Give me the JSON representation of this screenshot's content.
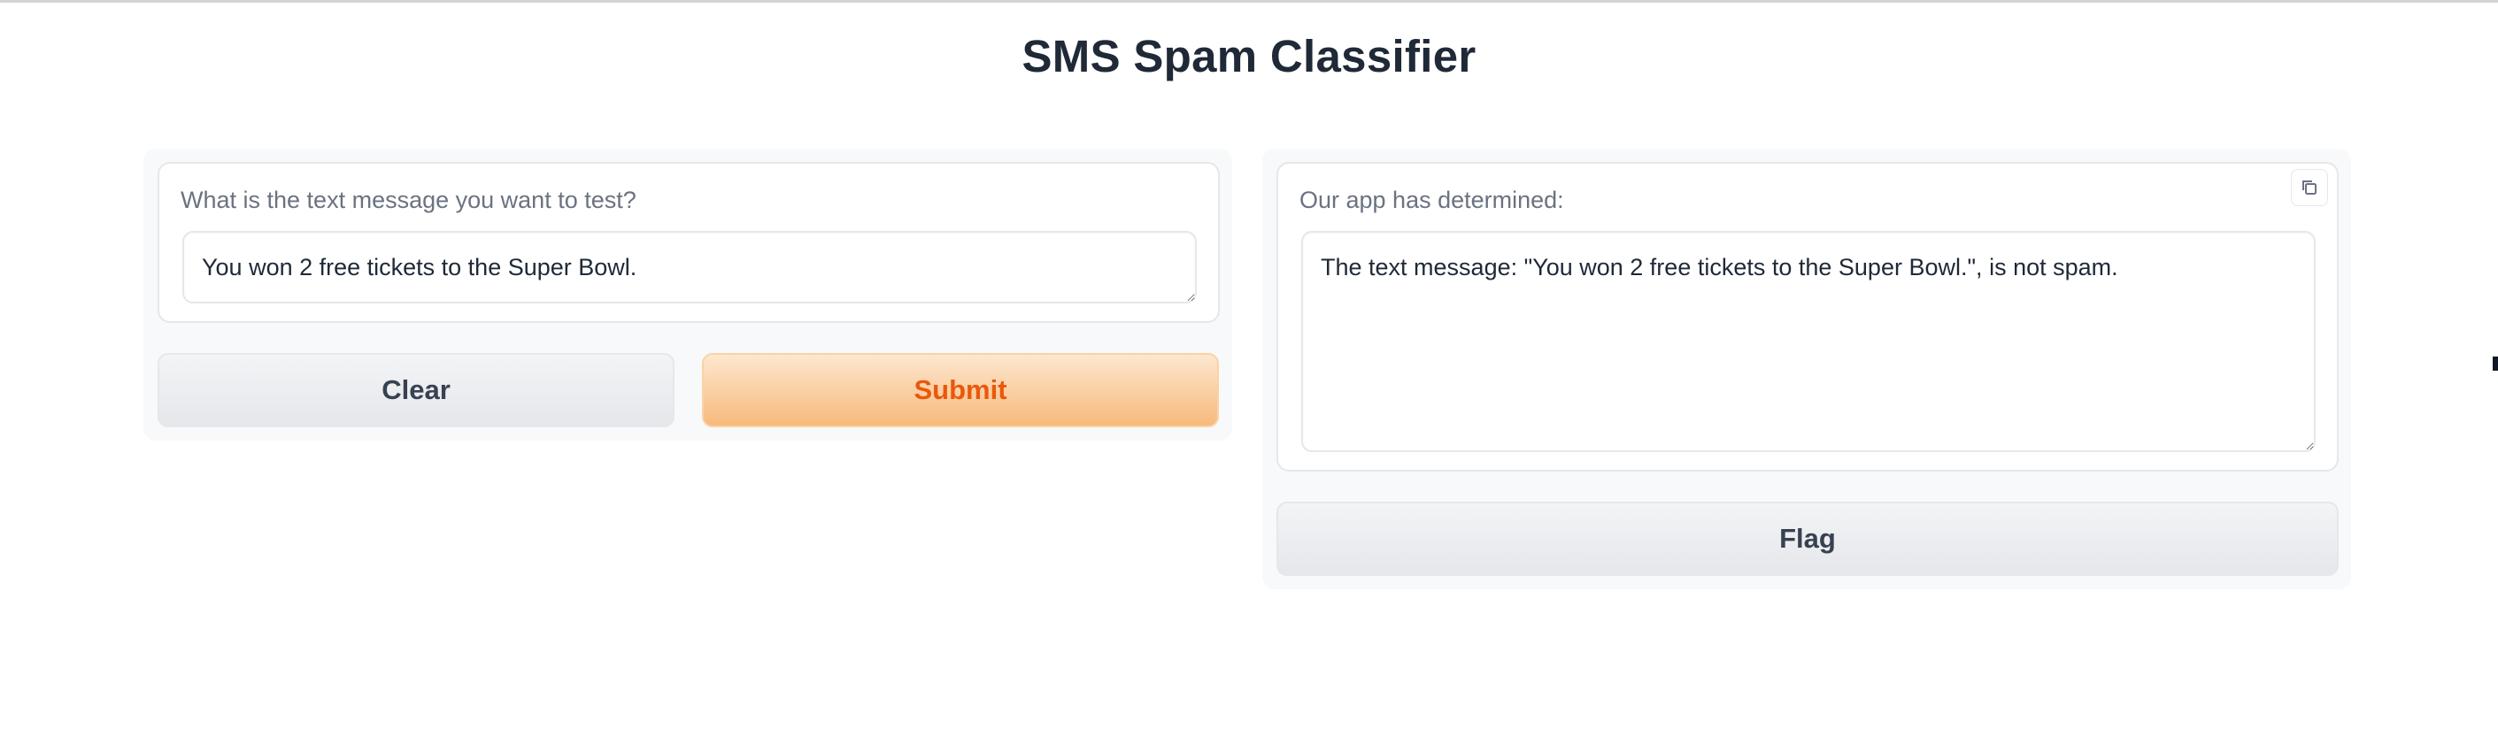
{
  "app": {
    "title": "SMS Spam Classifier"
  },
  "input_panel": {
    "label": "What is the text message you want to test?",
    "value": "You won 2 free tickets to the Super Bowl.",
    "clear_label": "Clear",
    "submit_label": "Submit"
  },
  "output_panel": {
    "label": "Our app has determined:",
    "value": "The text message: \"You won 2 free tickets to the Super Bowl.\", is not spam.",
    "copy_icon": "copy-icon",
    "flag_label": "Flag"
  },
  "colors": {
    "accent": "#ea580c",
    "primary_button_start": "#fde7cf",
    "primary_button_end": "#f7b97c",
    "panel_bg": "#f8f9fa"
  }
}
